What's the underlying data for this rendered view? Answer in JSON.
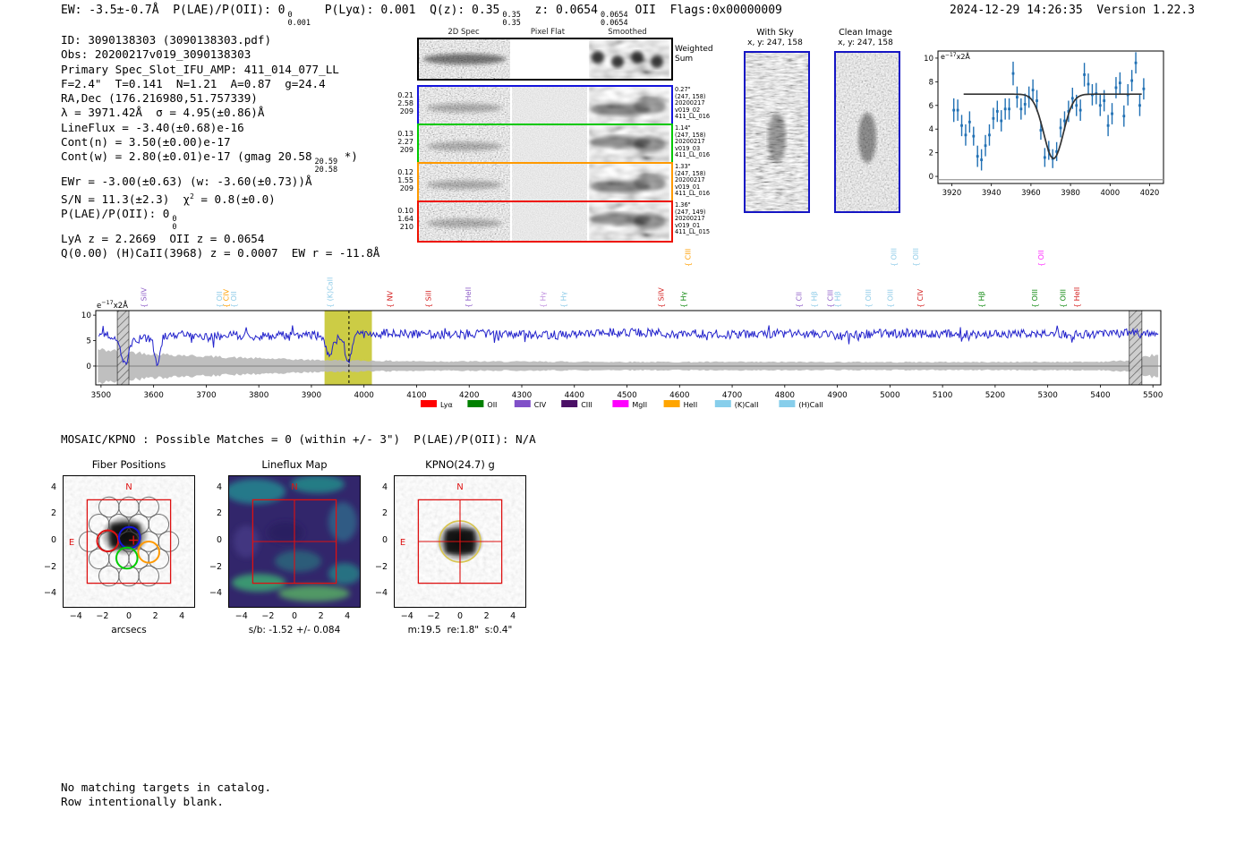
{
  "meta": {
    "datetime": "2024-12-29 14:26:35",
    "version": "Version 1.22.3"
  },
  "header": {
    "segments": [
      {
        "t": "EW: -3.5±-0.7Å  P(LAE)/P(OII): 0"
      },
      {
        "stack": [
          "0",
          "0.001"
        ]
      },
      {
        "t": "  P(Lyα): 0.001  Q(z): 0.35"
      },
      {
        "stack": [
          "0.35",
          "0.35"
        ]
      },
      {
        "t": "  z: 0.0654"
      },
      {
        "stack": [
          "0.0654",
          "0.0654"
        ]
      },
      {
        "t": " OII  Flags:0x00000009"
      }
    ]
  },
  "info_block": {
    "lines": [
      [
        {
          "t": "ID: 3090138303 (3090138303.pdf)"
        }
      ],
      [
        {
          "t": "Obs: 20200217v019_3090138303"
        }
      ],
      [
        {
          "t": "Primary Spec_Slot_IFU_AMP: 411_014_077_LL"
        }
      ],
      [
        {
          "t": "F=2.4\"  T=0.141  N=1.21  A=0.87  g=24.4"
        }
      ],
      [
        {
          "t": "RA,Dec (176.216980,51.757339)"
        }
      ],
      [
        {
          "t": "λ = 3971.42Å  σ = 4.95(±0.86)Å"
        }
      ],
      [
        {
          "t": "LineFlux = -3.40(±0.68)e-16"
        }
      ],
      [
        {
          "t": "Cont(n) = 3.50(±0.00)e-17"
        }
      ],
      [
        {
          "t": "Cont(w) = 2.80(±0.01)e-17 (gmag 20.58"
        },
        {
          "stack": [
            "20.59",
            "20.58"
          ]
        },
        {
          "t": " *)"
        }
      ],
      [
        {
          "t": "EWr = -3.00(±0.63) (w: -3.60(±0.73))Å"
        }
      ],
      [
        {
          "t": "S/N = 11.3(±2.3)  χ"
        },
        {
          "sup": "2"
        },
        {
          "t": " = 0.8(±0.0)"
        }
      ],
      [
        {
          "t": "P(LAE)/P(OII): 0"
        },
        {
          "stack": [
            "0",
            "0"
          ]
        }
      ],
      [
        {
          "t": "LyA z = 2.2669  OII z = 0.0654"
        }
      ],
      [
        {
          "t": "Q(0.00) (H)CaII(3968) z = 0.0007  EW r = -11.8Å"
        }
      ]
    ]
  },
  "spec2d": {
    "col_headers": [
      "2D Spec",
      "Pixel Flat",
      "Smoothed"
    ],
    "weighted_row": {
      "border": "#000000",
      "right_label": [
        "Weighted",
        "Sum"
      ]
    },
    "rows": [
      {
        "border": "#1414dc",
        "left": [
          "0.21",
          "2.58",
          "209"
        ],
        "right": [
          "0.27\"",
          "(247, 158)",
          "20200217",
          "v019_02",
          "411_LL_016"
        ]
      },
      {
        "border": "#00c800",
        "left": [
          "0.13",
          "2.27",
          "209"
        ],
        "right": [
          "1.14\"",
          "(247, 158)",
          "20200217",
          "v019_03",
          "411_LL_016"
        ]
      },
      {
        "border": "#ff9900",
        "left": [
          "0.12",
          "1.55",
          "209"
        ],
        "right": [
          "1.33\"",
          "(247, 158)",
          "20200217",
          "v019_01",
          "411_LL_016"
        ]
      },
      {
        "border": "#ee1100",
        "left": [
          "0.10",
          "1.64",
          "210"
        ],
        "right": [
          "1.36\"",
          "(247, 149)",
          "20200217",
          "v019_01",
          "411_LL_015"
        ]
      }
    ]
  },
  "cutouts": [
    {
      "title": "With Sky",
      "subtitle": "x, y: 247, 158",
      "border": "#1515c4"
    },
    {
      "title": "Clean Image",
      "subtitle": "x, y: 247, 158",
      "border": "#1515c4"
    }
  ],
  "chart_data": [
    {
      "id": "line_fit_plot",
      "type": "scatter",
      "title": "",
      "unit_label_segments": [
        {
          "t": "e"
        },
        {
          "sup": "−17"
        },
        {
          "t": "x2Å"
        }
      ],
      "xlim": [
        3913,
        4027
      ],
      "ylim": [
        -0.6,
        10.6
      ],
      "xticks": [
        3920,
        3940,
        3960,
        3980,
        4000,
        4020
      ],
      "yticks": [
        0,
        2,
        4,
        6,
        8,
        10
      ],
      "point_color": "#2070b4",
      "fit_color": "#333333",
      "points": [
        [
          3921,
          5.6,
          1.0
        ],
        [
          3923,
          5.6,
          0.9
        ],
        [
          3925,
          4.3,
          0.9
        ],
        [
          3927,
          3.5,
          0.9
        ],
        [
          3929,
          4.6,
          0.9
        ],
        [
          3931,
          3.4,
          0.8
        ],
        [
          3933,
          1.7,
          0.9
        ],
        [
          3935,
          1.4,
          0.9
        ],
        [
          3937,
          2.6,
          0.9
        ],
        [
          3939,
          3.5,
          0.9
        ],
        [
          3941,
          4.9,
          0.9
        ],
        [
          3943,
          5.5,
          0.9
        ],
        [
          3945,
          4.7,
          0.9
        ],
        [
          3947,
          5.7,
          0.9
        ],
        [
          3949,
          5.7,
          0.9
        ],
        [
          3951,
          8.7,
          1.0
        ],
        [
          3953,
          6.7,
          0.9
        ],
        [
          3955,
          5.7,
          0.9
        ],
        [
          3957,
          6.1,
          0.9
        ],
        [
          3959,
          6.7,
          0.9
        ],
        [
          3961,
          7.3,
          0.9
        ],
        [
          3963,
          6.4,
          0.9
        ],
        [
          3965,
          3.9,
          0.8
        ],
        [
          3967,
          1.6,
          0.8
        ],
        [
          3969,
          2.2,
          0.8
        ],
        [
          3971,
          1.5,
          0.8
        ],
        [
          3973,
          2.1,
          0.8
        ],
        [
          3975,
          4.1,
          0.8
        ],
        [
          3977,
          4.7,
          0.8
        ],
        [
          3979,
          5.5,
          0.9
        ],
        [
          3981,
          6.6,
          0.9
        ],
        [
          3983,
          6.0,
          0.9
        ],
        [
          3985,
          5.6,
          0.9
        ],
        [
          3987,
          8.6,
          1.0
        ],
        [
          3989,
          7.8,
          0.9
        ],
        [
          3991,
          6.9,
          0.9
        ],
        [
          3993,
          7.0,
          0.9
        ],
        [
          3995,
          6.0,
          0.9
        ],
        [
          3997,
          6.4,
          0.9
        ],
        [
          3999,
          4.3,
          0.9
        ],
        [
          4001,
          5.3,
          0.9
        ],
        [
          4003,
          7.5,
          0.9
        ],
        [
          4005,
          7.9,
          0.9
        ],
        [
          4007,
          5.1,
          0.9
        ],
        [
          4009,
          6.9,
          0.9
        ],
        [
          4011,
          8.1,
          0.9
        ],
        [
          4013,
          9.6,
          0.9
        ],
        [
          4015,
          6.0,
          0.9
        ],
        [
          4017,
          7.4,
          0.9
        ]
      ],
      "fit": {
        "continuum": 6.95,
        "center": 3971.4,
        "sigma": 4.95,
        "depth": 5.45,
        "xrange": [
          3926,
          4016
        ]
      }
    },
    {
      "id": "full_spectrum",
      "type": "line",
      "unit_label_segments": [
        {
          "t": "e"
        },
        {
          "sup": "−17"
        },
        {
          "t": "x2Å"
        }
      ],
      "xlim": [
        3490,
        5515
      ],
      "ylim": [
        -3.7,
        10.9
      ],
      "xticks": [
        3500,
        3600,
        3700,
        3800,
        3900,
        4000,
        4100,
        4200,
        4300,
        4400,
        4500,
        4600,
        4700,
        4800,
        4900,
        5000,
        5100,
        5200,
        5300,
        5400,
        5500
      ],
      "yticks": [
        0,
        5,
        10
      ],
      "line_color": "#2323cc",
      "highlight_band": {
        "x0": 3925,
        "x1": 4015,
        "color": "#c3c324"
      },
      "dashed_line_x": 3971.4,
      "hatched_bands": [
        [
          3531,
          3553
        ],
        [
          5455,
          5479
        ]
      ],
      "anchors": [
        [
          3500,
          6.2
        ],
        [
          3550,
          5.0
        ],
        [
          3600,
          5.6
        ],
        [
          3650,
          6.3
        ],
        [
          3700,
          5.6
        ],
        [
          3750,
          6.0
        ],
        [
          3800,
          5.9
        ],
        [
          3850,
          6.1
        ],
        [
          3900,
          6.2
        ],
        [
          3950,
          5.3
        ],
        [
          4000,
          6.3
        ],
        [
          4050,
          6.6
        ],
        [
          4100,
          6.3
        ],
        [
          4150,
          6.2
        ],
        [
          4200,
          6.4
        ],
        [
          4250,
          6.3
        ],
        [
          4300,
          6.2
        ],
        [
          4350,
          6.1
        ],
        [
          4400,
          6.3
        ],
        [
          4450,
          6.4
        ],
        [
          4500,
          6.7
        ],
        [
          4550,
          6.5
        ],
        [
          4600,
          6.3
        ],
        [
          4650,
          6.4
        ],
        [
          4700,
          6.2
        ],
        [
          4750,
          6.3
        ],
        [
          4800,
          6.4
        ],
        [
          4850,
          6.3
        ],
        [
          4900,
          6.2
        ],
        [
          4950,
          6.3
        ],
        [
          5000,
          6.4
        ],
        [
          5050,
          6.3
        ],
        [
          5100,
          6.4
        ],
        [
          5150,
          6.3
        ],
        [
          5200,
          6.2
        ],
        [
          5250,
          6.4
        ],
        [
          5300,
          6.3
        ],
        [
          5350,
          6.4
        ],
        [
          5400,
          6.3
        ],
        [
          5450,
          6.5
        ],
        [
          5500,
          6.2
        ]
      ],
      "dips": [
        [
          3545,
          4.8,
          6
        ],
        [
          3607,
          5.4,
          5
        ],
        [
          3933,
          3.6,
          6
        ],
        [
          3970,
          4.8,
          6
        ]
      ],
      "noise_amp": 0.85,
      "err_sigma_anchors": [
        [
          3500,
          3.2
        ],
        [
          3550,
          2.8
        ],
        [
          3600,
          2.4
        ],
        [
          3700,
          1.9
        ],
        [
          3800,
          1.5
        ],
        [
          3900,
          1.2
        ],
        [
          4000,
          1.05
        ],
        [
          4100,
          0.95
        ],
        [
          4200,
          0.9
        ],
        [
          4400,
          0.85
        ],
        [
          4600,
          0.8
        ],
        [
          4800,
          0.8
        ],
        [
          5000,
          0.78
        ],
        [
          5200,
          0.78
        ],
        [
          5400,
          0.85
        ],
        [
          5460,
          1.1
        ],
        [
          5500,
          2.2
        ]
      ],
      "line_labels": [
        {
          "text": "SiIV",
          "x": 3586,
          "color": "#8f5fc8",
          "tier": 0
        },
        {
          "text": "OII",
          "x": 3730,
          "color": "#8ecbe8",
          "tier": 0
        },
        {
          "text": "CIV",
          "x": 3743,
          "color": "#ff9f00",
          "tier": 0
        },
        {
          "text": "OII",
          "x": 3757,
          "color": "#8ecbe8",
          "tier": 0
        },
        {
          "text": "(K)CaII",
          "x": 3940,
          "color": "#8ecbe8",
          "tier": 0
        },
        {
          "text": "NV",
          "x": 4054,
          "color": "#d42020",
          "tier": 0
        },
        {
          "text": "SiII",
          "x": 4127,
          "color": "#d42020",
          "tier": 0
        },
        {
          "text": "HeII",
          "x": 4203,
          "color": "#8f5fc8",
          "tier": 0
        },
        {
          "text": "Hγ",
          "x": 4345,
          "color": "#bf8fdf",
          "tier": 0
        },
        {
          "text": "Hγ",
          "x": 4384,
          "color": "#8ecbe8",
          "tier": 0
        },
        {
          "text": "SiIV",
          "x": 4570,
          "color": "#d42020",
          "tier": 0
        },
        {
          "text": "Hγ",
          "x": 4612,
          "color": "#128a12",
          "tier": 0
        },
        {
          "text": "CIII",
          "x": 4621,
          "color": "#ff9f00",
          "tier": 1
        },
        {
          "text": "CII",
          "x": 4832,
          "color": "#8f5fc8",
          "tier": 0
        },
        {
          "text": "Hβ",
          "x": 4861,
          "color": "#8ecbe8",
          "tier": 0
        },
        {
          "text": "CIII",
          "x": 4891,
          "color": "#8f5fc8",
          "tier": 0
        },
        {
          "text": "Hβ",
          "x": 4905,
          "color": "#8ecbe8",
          "tier": 0
        },
        {
          "text": "OIII",
          "x": 4964,
          "color": "#8ecbe8",
          "tier": 0
        },
        {
          "text": "OIII",
          "x": 5005,
          "color": "#8ecbe8",
          "tier": 0
        },
        {
          "text": "OIII",
          "x": 5012,
          "color": "#8ecbe8",
          "tier": 1
        },
        {
          "text": "OIII",
          "x": 5054,
          "color": "#8ecbe8",
          "tier": 1
        },
        {
          "text": "CIV",
          "x": 5062,
          "color": "#d42020",
          "tier": 0
        },
        {
          "text": "Hβ",
          "x": 5179,
          "color": "#128a12",
          "tier": 0
        },
        {
          "text": "OIII",
          "x": 5280,
          "color": "#128a12",
          "tier": 0
        },
        {
          "text": "OII",
          "x": 5292,
          "color": "#ff2fff",
          "tier": 1
        },
        {
          "text": "OIII",
          "x": 5334,
          "color": "#128a12",
          "tier": 0
        },
        {
          "text": "HeII",
          "x": 5360,
          "color": "#d42020",
          "tier": 0
        }
      ],
      "legend": [
        {
          "label": "Lyα",
          "color": "#ff0000"
        },
        {
          "label": "OII",
          "color": "#008000"
        },
        {
          "label": "CIV",
          "color": "#8050c8"
        },
        {
          "label": "CIII",
          "color": "#4b0f66"
        },
        {
          "label": "MgII",
          "color": "#ff00ff"
        },
        {
          "label": "HeII",
          "color": "#ffa500"
        },
        {
          "label": "(K)CaII",
          "color": "#87ceeb"
        },
        {
          "label": "(H)CaII",
          "color": "#87ceeb"
        }
      ]
    }
  ],
  "mosaic": {
    "heading": "MOSAIC/KPNO : Possible Matches = 0 (within +/- 3\")  P(LAE)/P(OII): N/A",
    "panels": [
      {
        "id": "fiber_positions",
        "title": "Fiber Positions",
        "caption": "arcsecs",
        "xticks": [
          -4,
          -2,
          0,
          2,
          4
        ],
        "yticks": [
          4,
          2,
          0,
          -2,
          -4
        ],
        "compass": {
          "n": "N",
          "e": "E"
        }
      },
      {
        "id": "lineflux_map",
        "title": "Lineflux Map",
        "caption": "s/b: -1.52 +/- 0.084",
        "xticks": [
          -4,
          -2,
          0,
          2,
          4
        ],
        "yticks": [
          4,
          2,
          0,
          -2,
          -4
        ],
        "compass": {
          "n": "N"
        }
      },
      {
        "id": "kpno_g",
        "title": "KPNO(24.7) g",
        "caption": "m:19.5  re:1.8\"  s:0.4\"",
        "xticks": [
          -4,
          -2,
          0,
          2,
          4
        ],
        "yticks": [
          4,
          2,
          0,
          -2,
          -4
        ],
        "compass": {
          "n": "N",
          "e": "E"
        }
      }
    ]
  },
  "footer": {
    "lines": [
      "No matching targets in catalog.",
      "Row intentionally blank."
    ]
  }
}
